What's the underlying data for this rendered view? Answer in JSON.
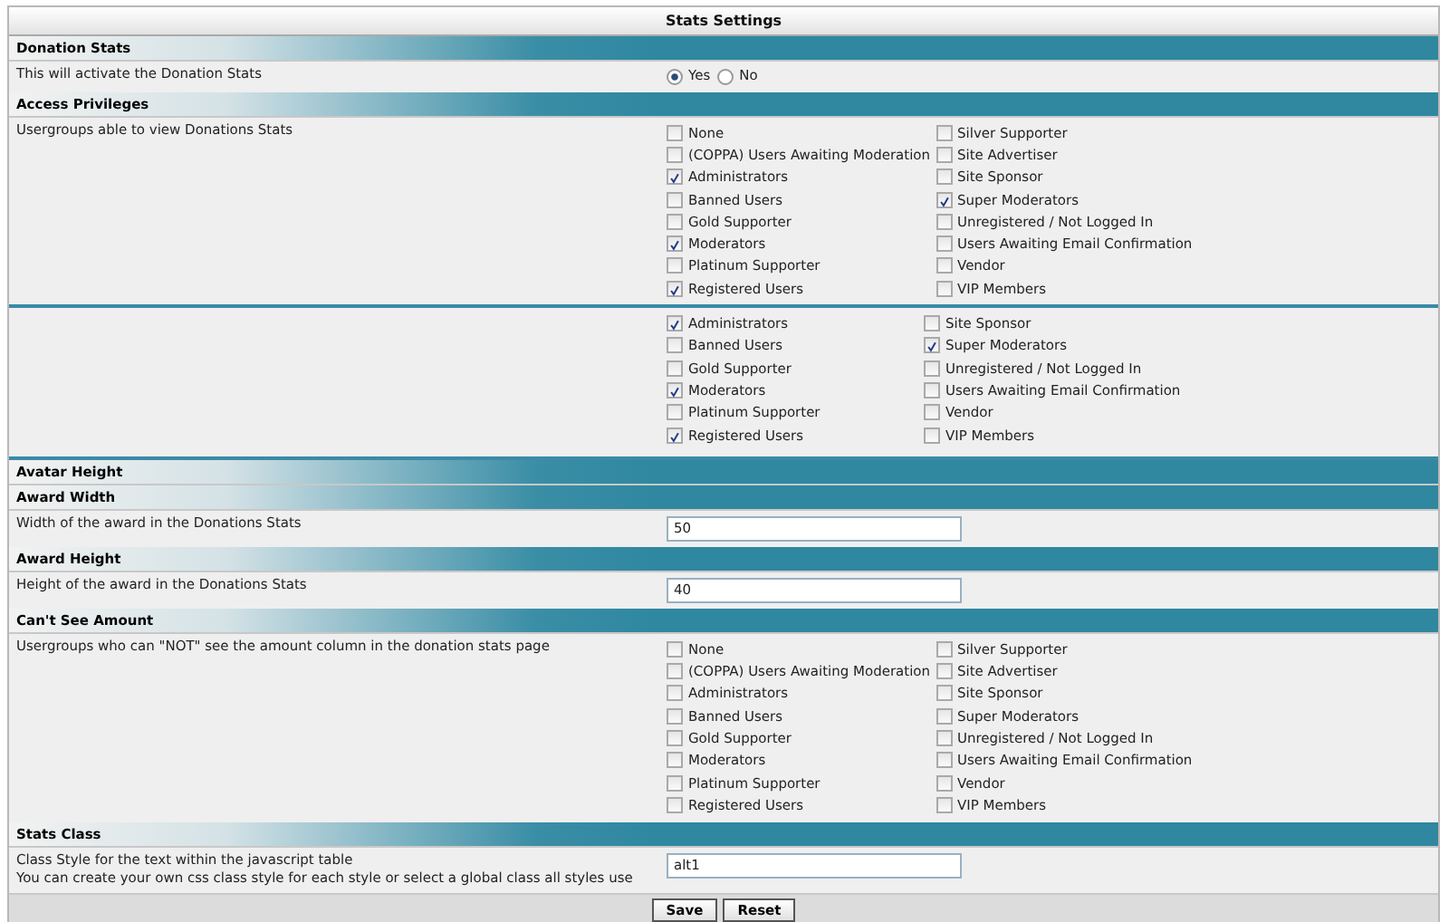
{
  "title": "Stats Settings",
  "sections": [
    {
      "heading": "Donation Stats",
      "rows": [
        {
          "kind": "radio",
          "label": "This will activate the Donation Stats",
          "options": [
            {
              "label": "Yes",
              "selected": true
            },
            {
              "label": "No",
              "selected": false
            }
          ]
        }
      ]
    },
    {
      "heading": "Access Privileges",
      "rows": [
        {
          "kind": "checkboxes",
          "label": "Usergroups able to view Donations Stats",
          "columns": [
            [
              {
                "label": "None",
                "checked": false
              },
              {
                "label": "(COPPA) Users Awaiting Moderation",
                "checked": false
              },
              {
                "label": "Administrators",
                "checked": true
              },
              {
                "label": "Banned Users",
                "checked": false
              },
              {
                "label": "Gold Supporter",
                "checked": false
              },
              {
                "label": "Moderators",
                "checked": true
              },
              {
                "label": "Platinum Supporter",
                "checked": false
              },
              {
                "label": "Registered Users",
                "checked": true
              }
            ],
            [
              {
                "label": "Silver Supporter",
                "checked": false
              },
              {
                "label": "Site Advertiser",
                "checked": false
              },
              {
                "label": "Site Sponsor",
                "checked": false
              },
              {
                "label": "Super Moderators",
                "checked": true
              },
              {
                "label": "Unregistered / Not Logged In",
                "checked": false
              },
              {
                "label": "Users Awaiting Email Confirmation",
                "checked": false
              },
              {
                "label": "Vendor",
                "checked": false
              },
              {
                "label": "VIP Members",
                "checked": false
              }
            ]
          ]
        },
        {
          "kind": "checkboxes",
          "columns": [
            [
              {
                "label": "Administrators",
                "checked": true
              },
              {
                "label": "Banned Users",
                "checked": false
              },
              {
                "label": "Gold Supporter",
                "checked": false
              },
              {
                "label": "Moderators",
                "checked": true
              },
              {
                "label": "Platinum Supporter",
                "checked": false
              },
              {
                "label": "Registered Users",
                "checked": true
              }
            ],
            [
              {
                "label": "Site Sponsor",
                "checked": false
              },
              {
                "label": "Super Moderators",
                "checked": true
              },
              {
                "label": "Unregistered / Not Logged In",
                "checked": false
              },
              {
                "label": "Users Awaiting Email Confirmation",
                "checked": false
              },
              {
                "label": "Vendor",
                "checked": false
              },
              {
                "label": "VIP Members",
                "checked": false
              }
            ]
          ]
        }
      ]
    },
    {
      "heading": "Avatar Height"
    },
    {
      "heading": "Award Width",
      "rows": [
        {
          "kind": "input",
          "label": "Width of the award in the Donations Stats",
          "value": "50"
        }
      ]
    },
    {
      "heading": "Award Height",
      "rows": [
        {
          "kind": "input",
          "label": "Height of the award in the Donations Stats",
          "value": "40"
        }
      ]
    },
    {
      "heading": "Can't See Amount",
      "rows": [
        {
          "kind": "checkboxes",
          "label": "Usergroups who can \"NOT\" see the amount column in the donation stats page",
          "columns": [
            [
              {
                "label": "None",
                "checked": false
              },
              {
                "label": "(COPPA) Users Awaiting Moderation",
                "checked": false
              },
              {
                "label": "Administrators",
                "checked": false
              },
              {
                "label": "Banned Users",
                "checked": false
              },
              {
                "label": "Gold Supporter",
                "checked": false
              },
              {
                "label": "Moderators",
                "checked": false
              },
              {
                "label": "Platinum Supporter",
                "checked": false
              },
              {
                "label": "Registered Users",
                "checked": false
              }
            ],
            [
              {
                "label": "Silver Supporter",
                "checked": false
              },
              {
                "label": "Site Advertiser",
                "checked": false
              },
              {
                "label": "Site Sponsor",
                "checked": false
              },
              {
                "label": "Super Moderators",
                "checked": false
              },
              {
                "label": "Unregistered / Not Logged In",
                "checked": false
              },
              {
                "label": "Users Awaiting Email Confirmation",
                "checked": false
              },
              {
                "label": "Vendor",
                "checked": false
              },
              {
                "label": "VIP Members",
                "checked": false
              }
            ]
          ]
        }
      ]
    },
    {
      "heading": "Stats Class",
      "rows": [
        {
          "kind": "input",
          "label": "Class Style for the text within the javascript table",
          "note": "You can create your own css class style for each style or select a global class all styles use",
          "value": "alt1"
        }
      ]
    }
  ],
  "buttons": [
    "Save",
    "Reset"
  ]
}
